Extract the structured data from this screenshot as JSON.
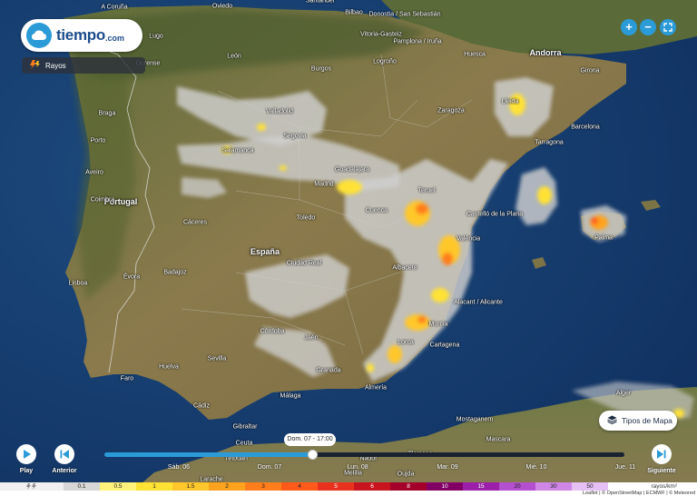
{
  "app": {
    "brand": "tiempo",
    "tld": ".com"
  },
  "layer": {
    "label": "Rayos",
    "icon": "lightning-icon"
  },
  "zoom": {
    "in_label": "+",
    "out_label": "−"
  },
  "map_types": {
    "label": "Tipos de Mapa",
    "icon": "layers-icon"
  },
  "map_labels": {
    "countries": [
      "Portugal",
      "España",
      "Andorra"
    ],
    "cities": [
      "A Coruña",
      "Oviedo",
      "Santander",
      "Bilbao",
      "Donostia / San Sebastián",
      "Pamplona / Iruña",
      "Vitoria-Gasteiz",
      "Burgos",
      "Logroño",
      "Huesca",
      "León",
      "Valladolid",
      "Zaragoza",
      "Girona",
      "Barcelona",
      "Tarragona",
      "Lleida",
      "Porto",
      "Salamanca",
      "Segovia",
      "Guadalajara",
      "Madrid",
      "Toledo",
      "Castelló de la Plana",
      "València",
      "Palma",
      "Badajoz",
      "Lisboa",
      "Albacete",
      "Alacant / Alicante",
      "Murcia",
      "Cartagena",
      "Lorca",
      "Córdoba",
      "Jaén",
      "Sevilla",
      "Granada",
      "Almería",
      "Huelva",
      "Cádiz",
      "Málaga",
      "Gibraltar",
      "Ceuta",
      "Melilla",
      "Alger",
      "Mostaganem",
      "Mascara",
      "Faro",
      "Tétouan",
      "Nador",
      "Tlemcen",
      "Larache",
      "Oujda",
      "Ourense",
      "Lugo",
      "Braga",
      "Aveiro",
      "Coimbra",
      "Évora",
      "Cáceres",
      "Cuenca",
      "Teruel",
      "Ciudad Real"
    ]
  },
  "player": {
    "play_label": "Play",
    "prev_label": "Anterior",
    "next_label": "Siguiente",
    "current_time": "Dom. 07 - 17:00",
    "progress": 0.4,
    "days": [
      "Sáb. 06",
      "Dom. 07",
      "Lun. 08",
      "Mar. 09",
      "Mié. 10",
      "Jue. 11"
    ]
  },
  "legend": {
    "values": [
      "0.1",
      "0.5",
      "1",
      "1.5",
      "2",
      "3",
      "4",
      "5",
      "6",
      "8",
      "10",
      "15",
      "20",
      "30",
      "50"
    ],
    "colors": [
      "#d7d7d7",
      "#fff27a",
      "#ffe234",
      "#ffc72b",
      "#ffa31e",
      "#ff7d1a",
      "#ff5a1a",
      "#e8321e",
      "#c8141e",
      "#a3002a",
      "#820066",
      "#9b1fa8",
      "#b44fcf",
      "#cf86e6",
      "#e6bff5"
    ],
    "unit": "rayos/km²",
    "attribution": "Leaflet | © OpenStreetMap | ECMWF | © Meteored"
  },
  "colors": {
    "accent": "#2b9bd8",
    "brand_text": "#1c4c8c"
  }
}
